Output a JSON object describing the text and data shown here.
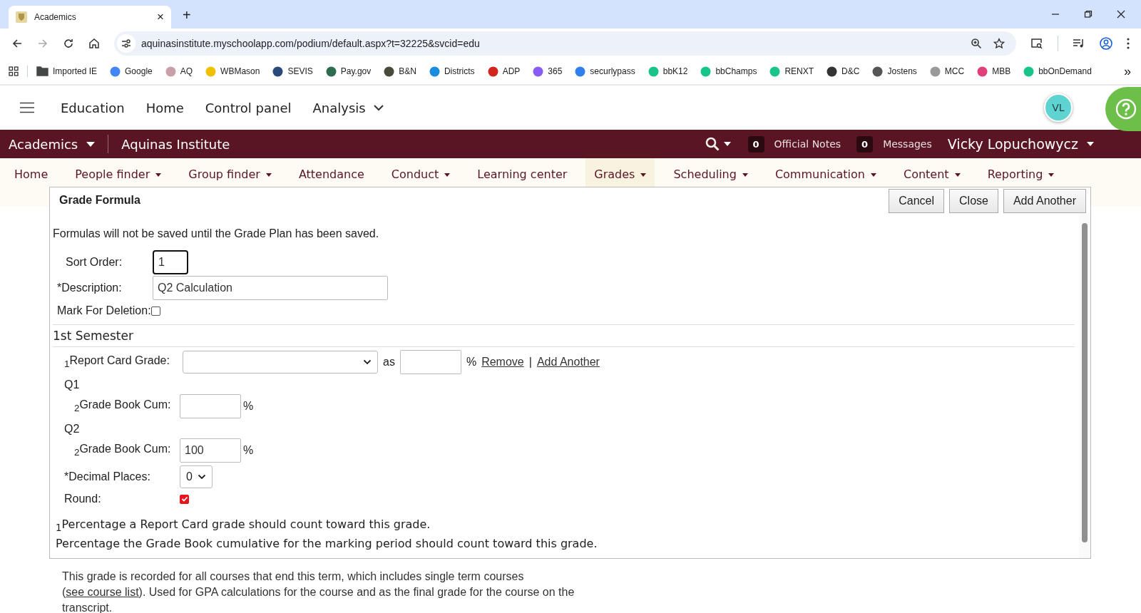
{
  "browser": {
    "tab_title": "Academics",
    "tab_close": "×",
    "new_tab": "+",
    "url": "aquinasinstitute.myschoolapp.com/podium/default.aspx?t=32225&svcid=edu",
    "bookmarks": [
      {
        "label": "Imported IE",
        "kind": "folder",
        "color": "#444746"
      },
      {
        "label": "Google",
        "kind": "site",
        "color": "#4285f4"
      },
      {
        "label": "AQ",
        "kind": "site",
        "color": "#c9a0a8"
      },
      {
        "label": "WBMason",
        "kind": "site",
        "color": "#f0c000"
      },
      {
        "label": "SEVIS",
        "kind": "site",
        "color": "#2a4a7a"
      },
      {
        "label": "Pay.gov",
        "kind": "site",
        "color": "#2f6b4f"
      },
      {
        "label": "B&N",
        "kind": "site",
        "color": "#4a4a3a"
      },
      {
        "label": "Districts",
        "kind": "site",
        "color": "#1a8ce0"
      },
      {
        "label": "ADP",
        "kind": "site",
        "color": "#d0271d"
      },
      {
        "label": "365",
        "kind": "site",
        "color": "#8a5cf6"
      },
      {
        "label": "securlypass",
        "kind": "site",
        "color": "#2f80ed"
      },
      {
        "label": "bbK12",
        "kind": "site",
        "color": "#19c48a"
      },
      {
        "label": "bbChamps",
        "kind": "site",
        "color": "#19c48a"
      },
      {
        "label": "RENXT",
        "kind": "site",
        "color": "#19c48a"
      },
      {
        "label": "D&C",
        "kind": "site",
        "color": "#333333"
      },
      {
        "label": "Jostens",
        "kind": "site",
        "color": "#555555"
      },
      {
        "label": "MCC",
        "kind": "site",
        "color": "#999999"
      },
      {
        "label": "MBB",
        "kind": "site",
        "color": "#e0407a"
      },
      {
        "label": "bbOnDemand",
        "kind": "site",
        "color": "#19c48a"
      }
    ],
    "bookmarks_more": "»"
  },
  "app_header": {
    "items": [
      "Education",
      "Home",
      "Control panel"
    ],
    "dropdown": "Analysis",
    "avatar": "VL"
  },
  "context_bar": {
    "module": "Academics",
    "school": "Aquinas Institute",
    "official_notes_count": "0",
    "official_notes": "Official Notes",
    "messages_count": "0",
    "messages": "Messages",
    "user": "Vicky Lopuchowycz"
  },
  "nav": [
    {
      "label": "Home",
      "dropdown": false,
      "selected": false
    },
    {
      "label": "People finder",
      "dropdown": true,
      "selected": false
    },
    {
      "label": "Group finder",
      "dropdown": true,
      "selected": false
    },
    {
      "label": "Attendance",
      "dropdown": false,
      "selected": false
    },
    {
      "label": "Conduct",
      "dropdown": true,
      "selected": false
    },
    {
      "label": "Learning center",
      "dropdown": false,
      "selected": false
    },
    {
      "label": "Grades",
      "dropdown": true,
      "selected": true
    },
    {
      "label": "Scheduling",
      "dropdown": true,
      "selected": false
    },
    {
      "label": "Communication",
      "dropdown": true,
      "selected": false
    },
    {
      "label": "Content",
      "dropdown": true,
      "selected": false
    },
    {
      "label": "Reporting",
      "dropdown": true,
      "selected": false
    }
  ],
  "dialog": {
    "title": "Grade Formula",
    "buttons": [
      "Cancel",
      "Close",
      "Add Another"
    ],
    "notice": "Formulas will not be saved until the Grade Plan has been saved.",
    "sort_order": {
      "label": "Sort Order:",
      "value": "1",
      "focused": true
    },
    "description": {
      "label": "*Description:",
      "value": "Q2 Calculation"
    },
    "mark_for_deletion": {
      "label": "Mark For Deletion:",
      "checked": false
    },
    "section": "1st Semester",
    "report_card": {
      "label": "$_{1}$Report Card Grade:",
      "as": "as",
      "percent": "%",
      "remove": "Remove",
      "separator": "|",
      "add_another": "Add Another"
    },
    "periods": [
      {
        "name": "Q1",
        "label": "$_{2}$Grade Book Cum:",
        "percent": "%"
      },
      {
        "name": "Q2",
        "label": "$_{2}$Grade Book Cum:",
        "value": "100",
        "percent": "%"
      }
    ],
    "decimal_places": {
      "label": "*Decimal Places:",
      "value": "0"
    },
    "round": {
      "label": "Round:",
      "checked": true
    },
    "footnotes": [
      "$_{1}$Percentage a Report Card grade should count toward this grade.",
      "Percentage the Grade Book cumulative for the marking period should count toward this grade."
    ]
  },
  "page_note": {
    "before": "This grade is recorded for all courses that end this term, which includes single term courses (",
    "link": "see course list",
    "after": "). Used for GPA calculations for the course and as the final grade for the course on the transcript."
  }
}
